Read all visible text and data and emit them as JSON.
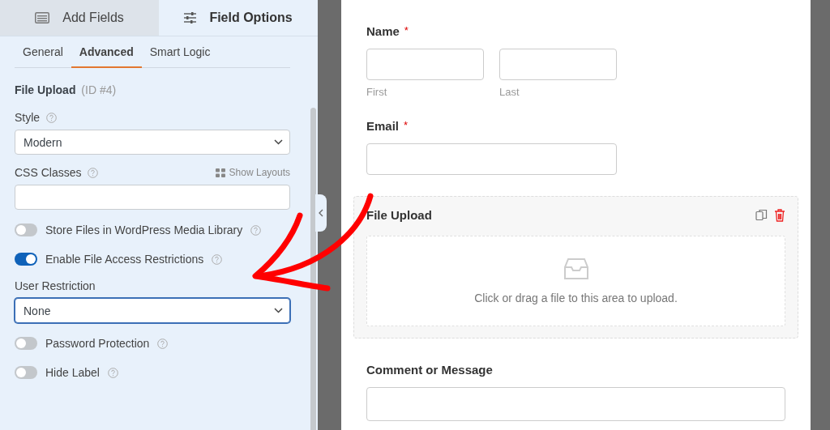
{
  "panel_tabs": [
    {
      "label": "Add Fields",
      "selected": false
    },
    {
      "label": "Field Options",
      "selected": true
    }
  ],
  "sub_tabs": [
    {
      "label": "General",
      "selected": false
    },
    {
      "label": "Advanced",
      "selected": true
    },
    {
      "label": "Smart Logic",
      "selected": false
    }
  ],
  "field_heading": {
    "title": "File Upload",
    "id_label": "(ID #4)"
  },
  "options": [
    {
      "kind": "select",
      "label": "Style",
      "help": true,
      "value": "Modern",
      "focused": false
    },
    {
      "kind": "text",
      "label": "CSS Classes",
      "help": true,
      "link": "Show Layouts"
    },
    {
      "kind": "toggle",
      "label": "Store Files in WordPress Media Library",
      "on": false
    },
    {
      "kind": "toggle",
      "label": "Enable File Access Restrictions",
      "on": true
    },
    {
      "kind": "select",
      "label": "User Restriction",
      "value": "None",
      "focused": true
    },
    {
      "kind": "toggle",
      "label": "Password Protection",
      "on": false
    },
    {
      "kind": "toggle",
      "label": "Hide Label",
      "on": false
    }
  ],
  "form": [
    {
      "kind": "name",
      "label": "Name",
      "marker": "*",
      "sublabels": [
        "First",
        "Last"
      ]
    },
    {
      "kind": "email",
      "label": "Email",
      "marker": "*"
    },
    {
      "kind": "upload",
      "label": "File Upload",
      "hint": "Click or drag a file to this area to upload."
    },
    {
      "kind": "textarea",
      "label": "Comment or Message"
    }
  ]
}
